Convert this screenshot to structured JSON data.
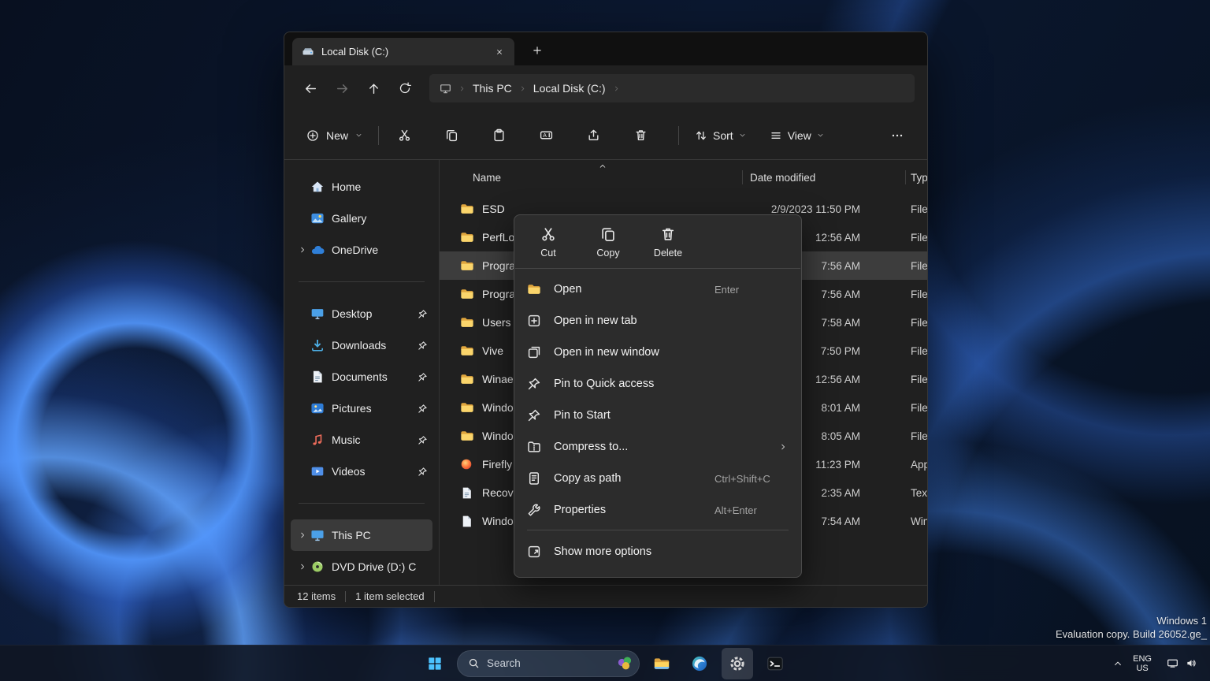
{
  "explorer": {
    "tab_title": "Local Disk (C:)",
    "breadcrumb": {
      "this_pc": "This PC",
      "drive": "Local Disk (C:)"
    },
    "toolbar": {
      "new": "New",
      "sort": "Sort",
      "view": "View"
    },
    "columns": {
      "name": "Name",
      "date": "Date modified",
      "type": "Typ"
    },
    "sidebar": [
      {
        "label": "Home"
      },
      {
        "label": "Gallery"
      },
      {
        "label": "OneDrive"
      },
      {
        "label": "Desktop"
      },
      {
        "label": "Downloads"
      },
      {
        "label": "Documents"
      },
      {
        "label": "Pictures"
      },
      {
        "label": "Music"
      },
      {
        "label": "Videos"
      },
      {
        "label": "This PC"
      },
      {
        "label": "DVD Drive (D:) C"
      }
    ],
    "rows": [
      {
        "name": "ESD",
        "date": "2/9/2023 11:50 PM",
        "type": "File"
      },
      {
        "name": "PerfLogs",
        "date": "12:56 AM",
        "type": "File"
      },
      {
        "name": "Progra",
        "date": "7:56 AM",
        "type": "File"
      },
      {
        "name": "Progra",
        "date": "7:56 AM",
        "type": "File"
      },
      {
        "name": "Users",
        "date": "7:58 AM",
        "type": "File"
      },
      {
        "name": "Vive",
        "date": "7:50 PM",
        "type": "File"
      },
      {
        "name": "Winaer",
        "date": "12:56 AM",
        "type": "File"
      },
      {
        "name": "Windo",
        "date": "8:01 AM",
        "type": "File"
      },
      {
        "name": "Windo",
        "date": "8:05 AM",
        "type": "File"
      },
      {
        "name": "Firefly",
        "date": "11:23 PM",
        "type": "App"
      },
      {
        "name": "Recove",
        "date": "2:35 AM",
        "type": "Text"
      },
      {
        "name": "Windo",
        "date": "7:54 AM",
        "type": "Win"
      }
    ],
    "status": {
      "count": "12 items",
      "selected": "1 item selected"
    }
  },
  "menu": {
    "quick": [
      {
        "label": "Cut"
      },
      {
        "label": "Copy"
      },
      {
        "label": "Delete"
      }
    ],
    "items": [
      {
        "label": "Open",
        "shortcut": "Enter"
      },
      {
        "label": "Open in new tab"
      },
      {
        "label": "Open in new window"
      },
      {
        "label": "Pin to Quick access"
      },
      {
        "label": "Pin to Start"
      },
      {
        "label": "Compress to..."
      },
      {
        "label": "Copy as path",
        "shortcut": "Ctrl+Shift+C"
      },
      {
        "label": "Properties",
        "shortcut": "Alt+Enter"
      },
      {
        "label": "Show more options"
      }
    ]
  },
  "watermark": {
    "line1": "Windows 1",
    "line2": "Evaluation copy. Build 26052.ge_"
  },
  "taskbar": {
    "search_placeholder": "Search",
    "lang_line1": "ENG",
    "lang_line2": "US"
  },
  "colors": {
    "accent_blue": "#4cc2ff",
    "folder_yellow": "#ffd45e",
    "selection_gray": "#3d3d3d"
  }
}
